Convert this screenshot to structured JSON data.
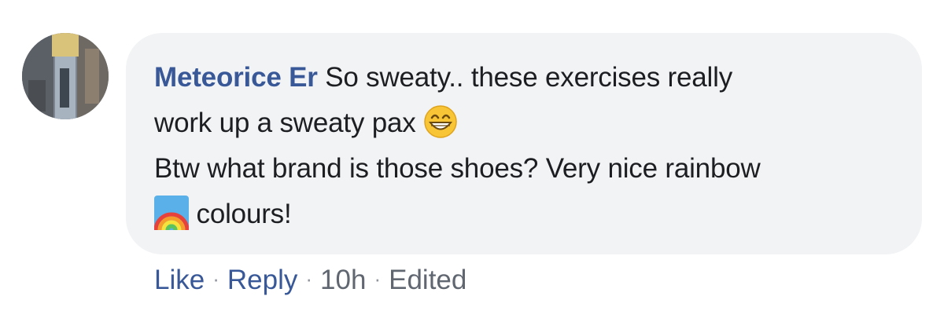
{
  "comment": {
    "author": "Meteorice Er",
    "lines": {
      "line1": "So sweaty.. these exercises really",
      "line2": "work up a sweaty pax",
      "line3": "Btw what brand is those shoes? Very nice rainbow",
      "line4": "colours!"
    },
    "emojis": {
      "grin": "grinning-face-with-smiling-eyes-icon",
      "rainbow": "rainbow-icon"
    },
    "actions": {
      "like": "Like",
      "reply": "Reply",
      "time": "10h",
      "edited": "Edited",
      "separator": "·"
    }
  },
  "colors": {
    "bubble_bg": "#f2f3f5",
    "author": "#385898",
    "text": "#1c1e21",
    "meta": "#606770"
  }
}
